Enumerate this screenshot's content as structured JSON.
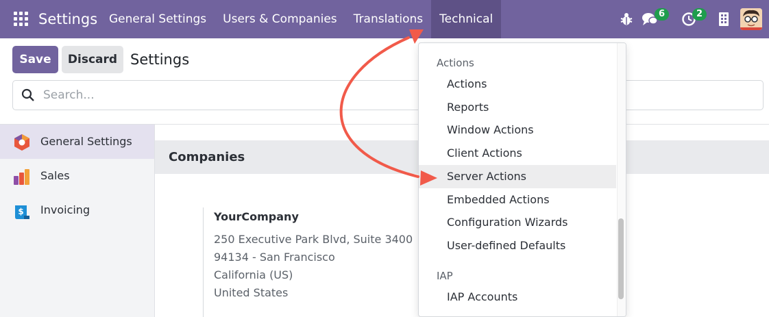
{
  "navbar": {
    "app_name": "Settings",
    "menu": [
      {
        "label": "General Settings"
      },
      {
        "label": "Users & Companies"
      },
      {
        "label": "Translations"
      },
      {
        "label": "Technical",
        "active": true
      }
    ],
    "icons": [
      "apps-grid-icon",
      "bug-icon",
      "chat-icon",
      "clock-icon",
      "building-icon"
    ],
    "messages_badge": "6",
    "activities_badge": "2",
    "badge_color": "#1f9d4d",
    "brand_color": "#71639e"
  },
  "control_panel": {
    "save_label": "Save",
    "discard_label": "Discard",
    "title": "Settings",
    "search_placeholder": "Search..."
  },
  "sidebar": {
    "items": [
      {
        "label": "General Settings",
        "icon": "settings-hexagon-icon",
        "active": true
      },
      {
        "label": "Sales",
        "icon": "sales-chart-icon"
      },
      {
        "label": "Invoicing",
        "icon": "invoicing-dollar-icon"
      }
    ]
  },
  "content": {
    "section_title": "Companies",
    "company": {
      "name": "YourCompany",
      "address_lines": [
        "250 Executive Park Blvd, Suite 3400",
        "94134 - San Francisco",
        "California (US)",
        "United States"
      ]
    }
  },
  "dropdown": {
    "groups": [
      {
        "header": "Actions",
        "items": [
          "Actions",
          "Reports",
          "Window Actions",
          "Client Actions",
          "Server Actions",
          "Embedded Actions",
          "Configuration Wizards",
          "User-defined Defaults"
        ]
      },
      {
        "header": "IAP",
        "items": [
          "IAP Accounts"
        ]
      }
    ],
    "highlighted_item": "Server Actions"
  },
  "annotation": {
    "arrow_color": "#f15a4a"
  }
}
